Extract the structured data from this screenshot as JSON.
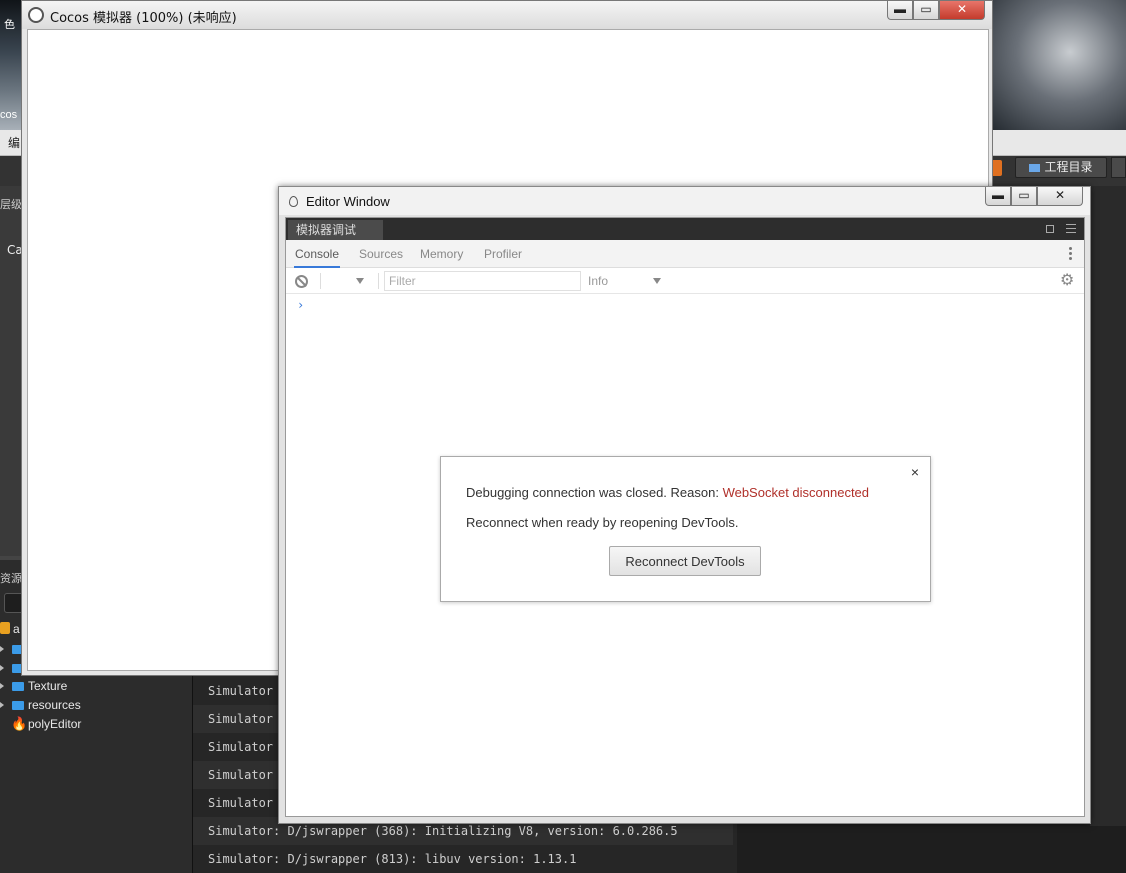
{
  "simulator": {
    "title": "Cocos 模拟器 (100%) (未响应)",
    "min": "▬",
    "max": "▭",
    "close": "✕"
  },
  "editor_window": {
    "title": "Editor Window",
    "min": "▬",
    "max": "▭",
    "close": "✕",
    "devtools_tab": "模拟器调试",
    "panels": [
      "Console",
      "Sources",
      "Memory",
      "Profiler"
    ],
    "filter_placeholder": "Filter",
    "level": "Info",
    "prompt": "›"
  },
  "dialog": {
    "close": "×",
    "message_prefix": "Debugging connection was closed. Reason: ",
    "reason": "WebSocket disconnected",
    "message2": "Reconnect when ready by reopening DevTools.",
    "button": "Reconnect DevTools"
  },
  "background": {
    "project_dir_button": "工程目录",
    "left_labels": [
      "色",
      "cos",
      "编",
      "层级",
      "Ca",
      "资源",
      "a"
    ],
    "assets": [
      {
        "name": "",
        "type": "folder"
      },
      {
        "name": "",
        "type": "folder"
      },
      {
        "name": "Texture",
        "type": "folder"
      },
      {
        "name": "resources",
        "type": "folder"
      },
      {
        "name": "polyEditor",
        "type": "flame"
      }
    ]
  },
  "console_lines": [
    "Simulator",
    "Simulator",
    "Simulator",
    "Simulator",
    "Simulator",
    "Simulator: D/jswrapper (368): Initializing V8, version: 6.0.286.5",
    "Simulator: D/jswrapper (813): libuv version: 1.13.1"
  ],
  "colors": {
    "accent_blue": "#3879d9",
    "error_red": "#b0302a"
  }
}
